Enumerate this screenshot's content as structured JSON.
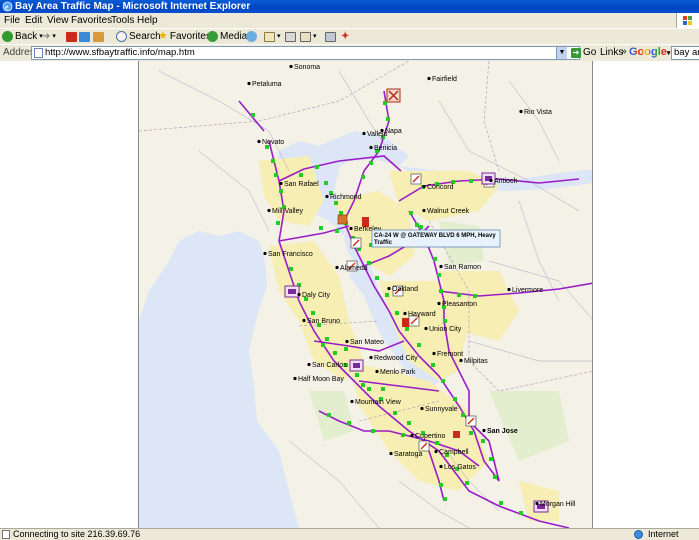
{
  "window": {
    "title": "Bay Area Traffic Map - Microsoft Internet Explorer"
  },
  "menu": [
    "File",
    "Edit",
    "View",
    "Favorites",
    "Tools",
    "Help"
  ],
  "toolbar": {
    "back": "Back",
    "search": "Search",
    "favorites": "Favorites",
    "media": "Media"
  },
  "address": {
    "label": "Address",
    "url": "http://www.sfbaytraffic.info/map.htm",
    "go": "Go",
    "links": "Links"
  },
  "google": {
    "logo": "Google",
    "search_value": "bay area"
  },
  "map": {
    "cities": [
      "Sonoma",
      "Petaluma",
      "Fairfield",
      "Napa",
      "Novato",
      "Vallejo",
      "Rio Vista",
      "Benicia",
      "Concord",
      "Antioch",
      "San Rafael",
      "Richmond",
      "Mill Valley",
      "Berkeley",
      "Walnut Creek",
      "San Francisco",
      "Alameda",
      "San Ramon",
      "Daly City",
      "Oakland",
      "Livermore",
      "Pleasanton",
      "San Bruno",
      "Hayward",
      "Union City",
      "San Mateo",
      "Fremont",
      "Redwood City",
      "Half Moon Bay",
      "San Carlos",
      "Menlo Park",
      "Milpitas",
      "Mountain View",
      "Sunnyvale",
      "San Jose",
      "Cupertino",
      "Campbell",
      "Saratoga",
      "Los Gatos",
      "Morgan Hill"
    ],
    "popup": {
      "line1": "CA-24 W @ GATEWAY BLVD 6 MPH, Heavy",
      "line2": "Traffic"
    }
  },
  "status": {
    "message": "Connecting to site 216.39.69.76",
    "zone": "Internet"
  }
}
